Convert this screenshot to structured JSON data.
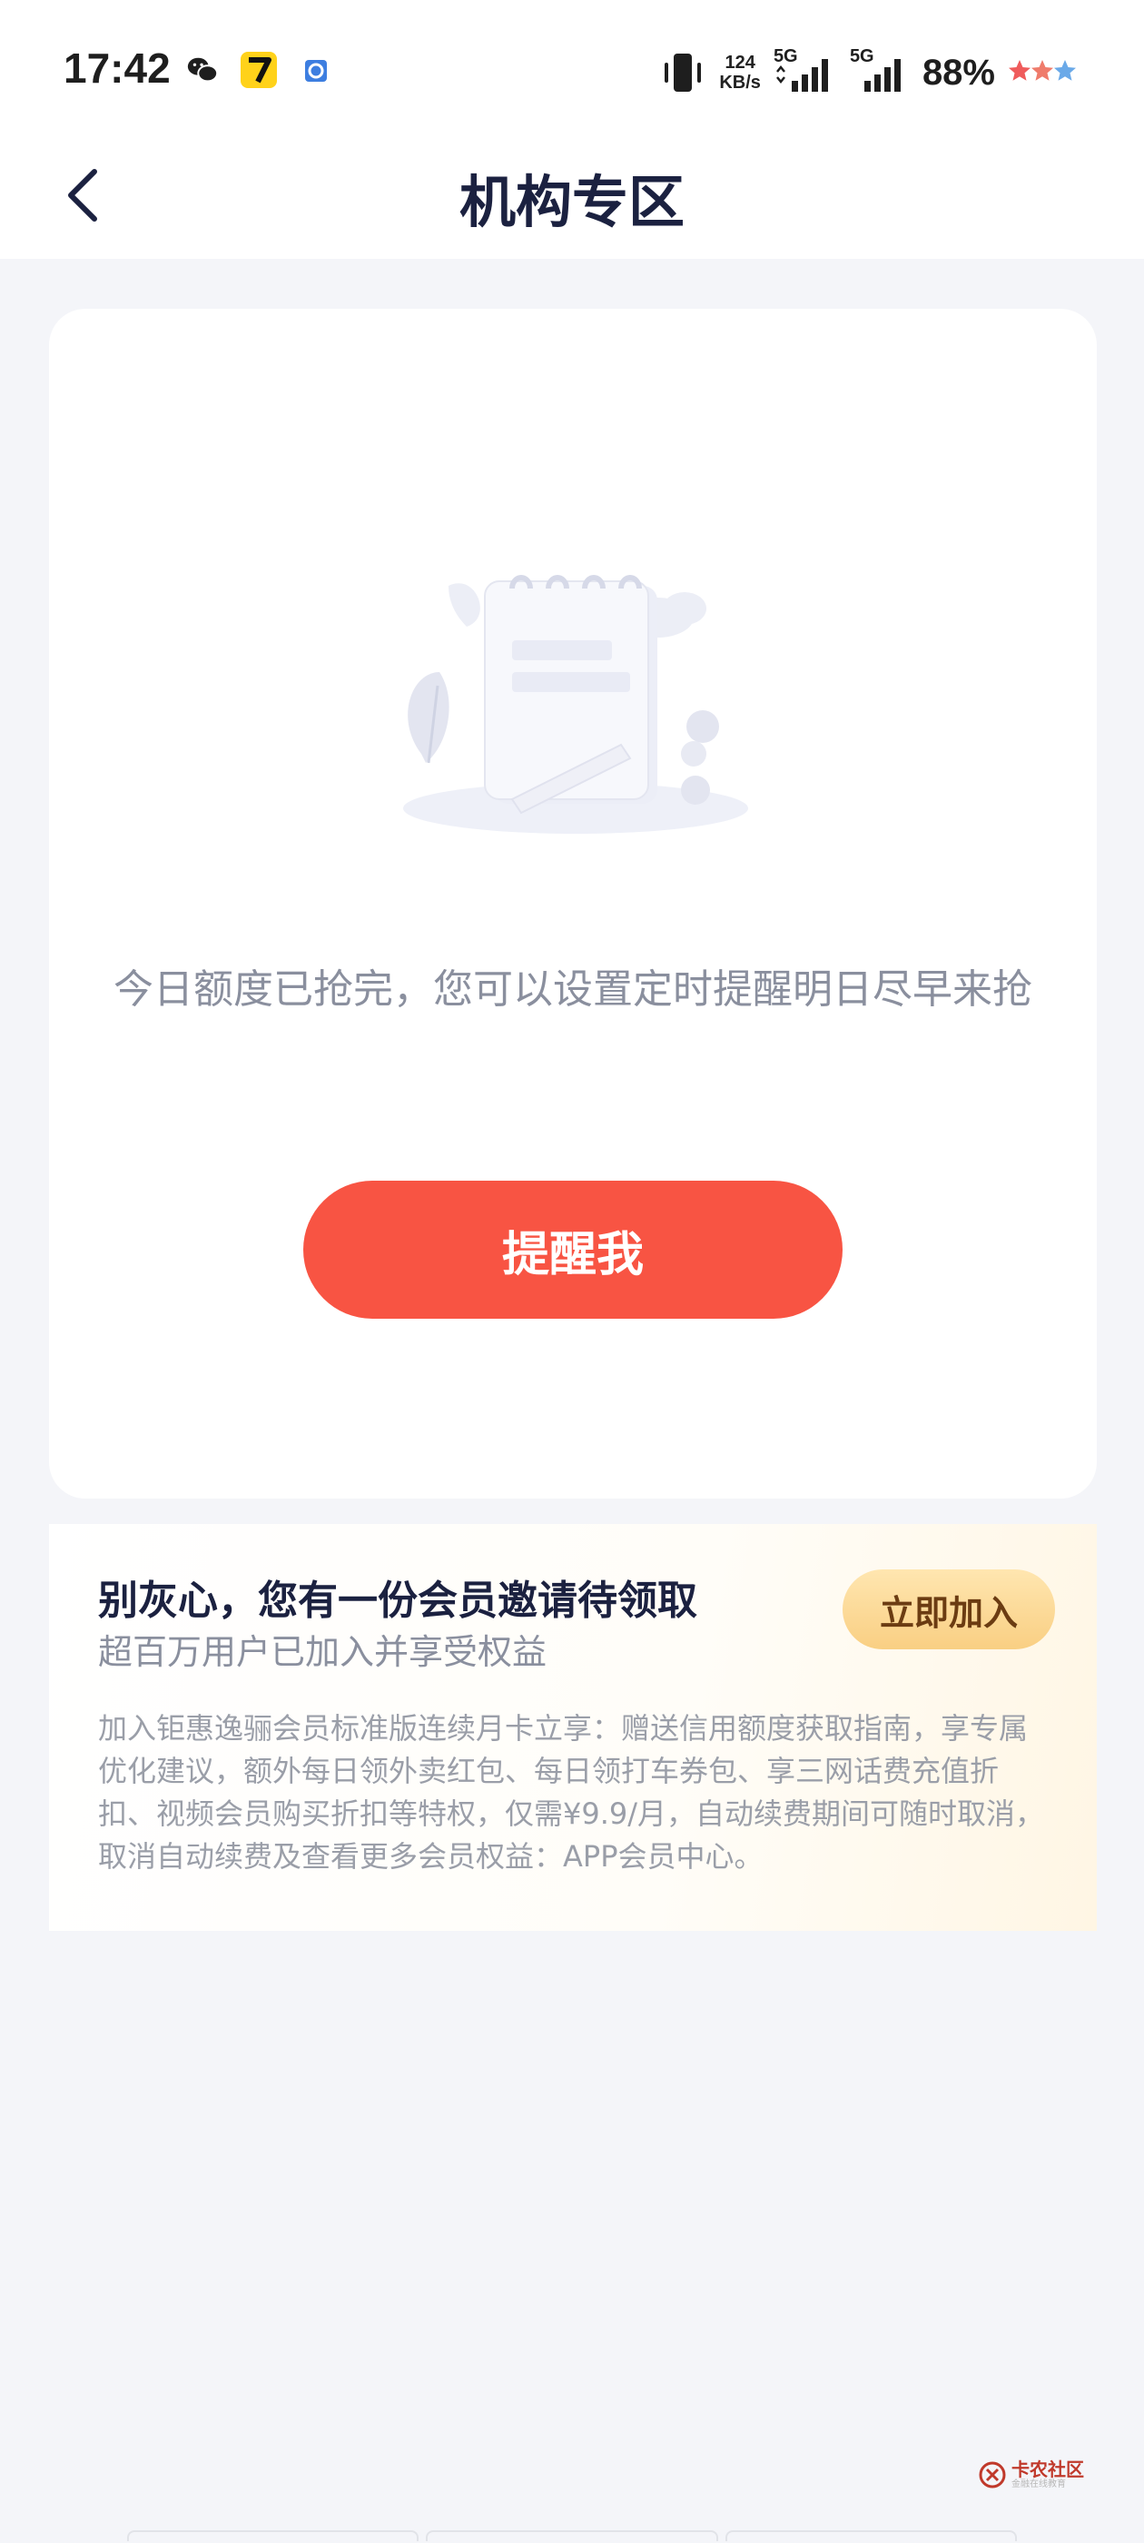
{
  "status_bar": {
    "time": "17:42",
    "network_speed_value": "124",
    "network_speed_unit": "KB/s",
    "sim1": "5G",
    "sim2": "5G",
    "battery": "88%"
  },
  "nav": {
    "title": "机构专区",
    "back_icon": "chevron-left-icon"
  },
  "empty_state": {
    "message": "今日额度已抢完，您可以设置定时提醒明日尽早来抢",
    "remind_button": "提醒我"
  },
  "member_promo": {
    "title": "别灰心，您有一份会员邀请待领取",
    "subtitle": "超百万用户已加入并享受权益",
    "join_button": "立即加入",
    "description": "加入钜惠逸骊会员标准版连续月卡立享：赠送信用额度获取指南，享专属优化建议，额外每日领外卖红包、每日领打车券包、享三网话费充值折扣、视频会员购买折扣等特权，仅需¥9.9/月，自动续费期间可随时取消，取消自动续费及查看更多会员权益：APP会员中心。"
  },
  "watermark": {
    "name": "卡农社区",
    "tagline": "金融在线教育"
  },
  "colors": {
    "accent_red": "#f85443",
    "title_navy": "#1b2140",
    "muted_gray": "#8a8f9e",
    "gold_button": "#f9cf83"
  }
}
